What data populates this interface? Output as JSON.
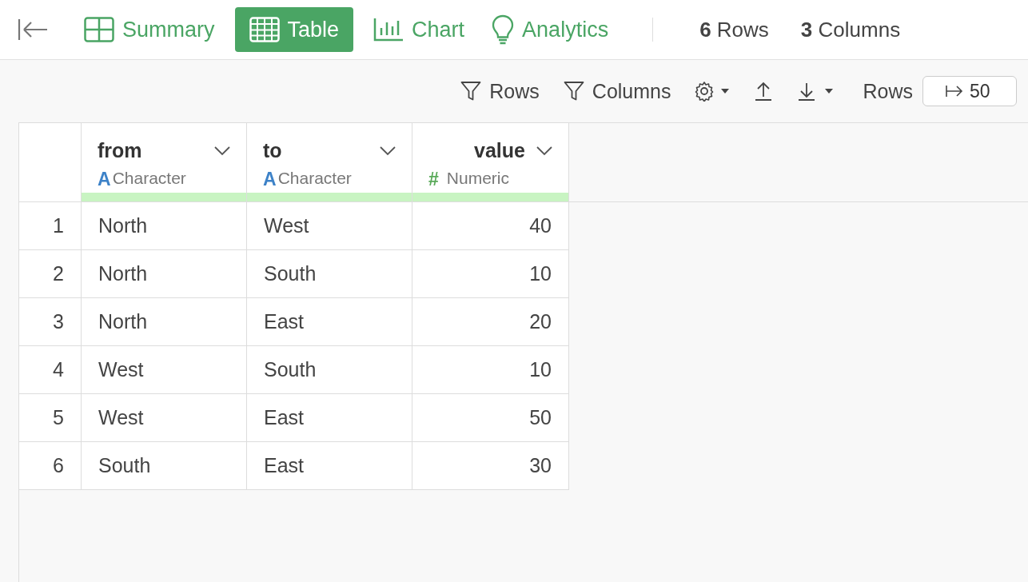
{
  "tabs": [
    {
      "label": "Summary",
      "kind": "grid",
      "selected": false
    },
    {
      "label": "Table",
      "kind": "table",
      "selected": true
    },
    {
      "label": "Chart",
      "kind": "chart",
      "selected": false
    },
    {
      "label": "Analytics",
      "kind": "bulb",
      "selected": false
    }
  ],
  "summary": [
    "**6** Rows",
    "**3** Columns"
  ],
  "toolbar": [
    {
      "kind": "filter",
      "label": "Rows"
    },
    {
      "kind": "filter",
      "label": "Columns"
    },
    {
      "kind": "settings"
    },
    {
      "kind": "upload"
    },
    {
      "kind": "download"
    }
  ],
  "row_limit": {
    "label": "Rows",
    "value": "50"
  },
  "table": {
    "columns": [
      {
        "kind": "index"
      },
      {
        "name": "from",
        "type_mark": "A",
        "type": "Character",
        "kind": "character"
      },
      {
        "name": "to",
        "type_mark": "A",
        "type": "Character",
        "kind": "character"
      },
      {
        "name": "value",
        "type_mark": "#",
        "type": "Numeric",
        "kind": "numeric"
      }
    ],
    "rows": [
      [
        "1",
        "North",
        "West",
        "40"
      ],
      [
        "2",
        "North",
        "South",
        "10"
      ],
      [
        "3",
        "North",
        "East",
        "20"
      ],
      [
        "4",
        "West",
        "South",
        "10"
      ],
      [
        "5",
        "West",
        "East",
        "50"
      ],
      [
        "6",
        "South",
        "East",
        "30"
      ]
    ]
  }
}
